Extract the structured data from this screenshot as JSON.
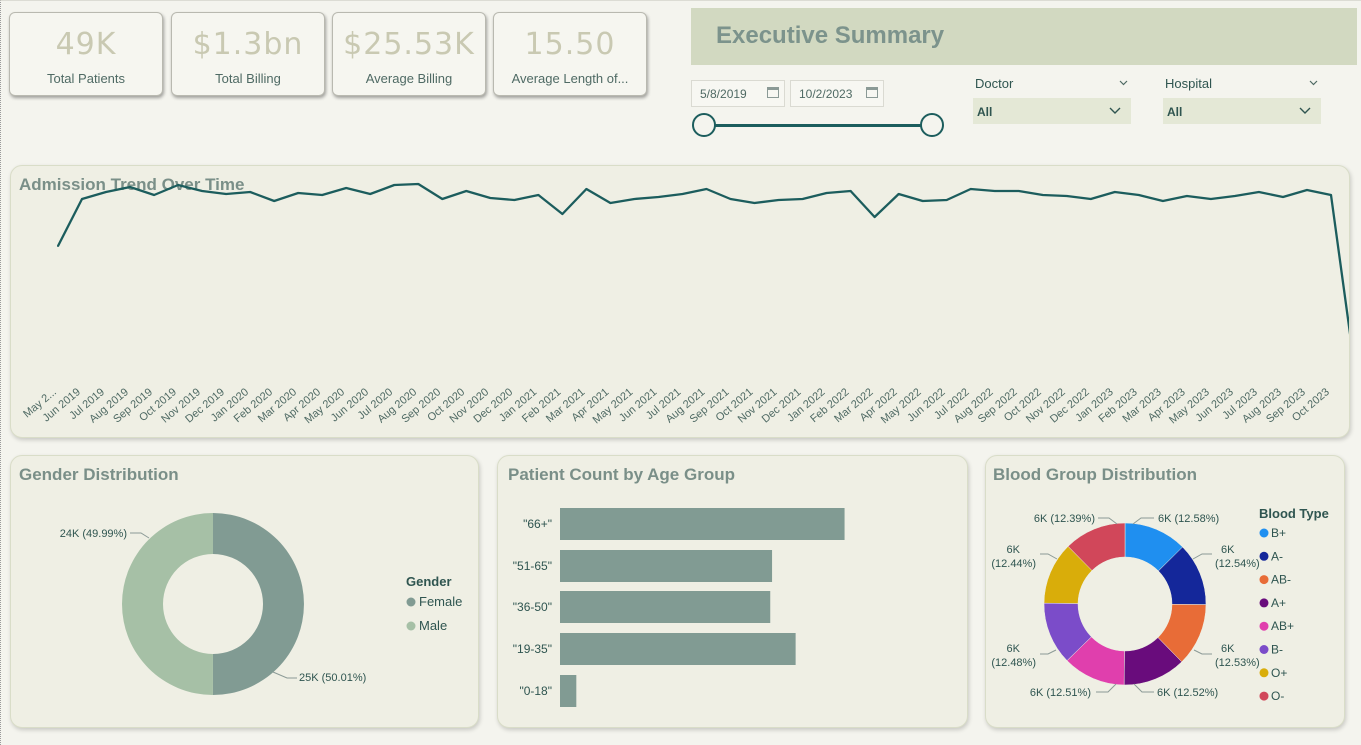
{
  "kpis": [
    {
      "value": "49K",
      "label": "Total Patients"
    },
    {
      "value": "$1.3bn",
      "label": "Total Billing"
    },
    {
      "value": "$25.53K",
      "label": "Average Billing"
    },
    {
      "value": "15.50",
      "label": "Average Length of..."
    }
  ],
  "header": {
    "title": "Executive Summary"
  },
  "date_range": {
    "start": "5/8/2019",
    "end": "10/2/2023"
  },
  "filters": {
    "doctor": {
      "label": "Doctor",
      "value": "All"
    },
    "hospital": {
      "label": "Hospital",
      "value": "All"
    }
  },
  "panels": {
    "trend": {
      "title": "Admission Trend Over Time"
    },
    "gender": {
      "title": "Gender Distribution"
    },
    "age": {
      "title": "Patient Count by Age Group"
    },
    "blood": {
      "title": "Blood Group Distribution"
    }
  },
  "colors": {
    "teal": "#1c5d5d",
    "gender_female": "#819b93",
    "gender_male": "#a6c0a6",
    "bar": "#819b93"
  },
  "chart_data": [
    {
      "type": "line",
      "title": "Admission Trend Over Time",
      "x": [
        "May 2...",
        "Jun 2019",
        "Jul 2019",
        "Aug 2019",
        "Sep 2019",
        "Oct 2019",
        "Nov 2019",
        "Dec 2019",
        "Jan 2020",
        "Feb 2020",
        "Mar 2020",
        "Apr 2020",
        "May 2020",
        "Jun 2020",
        "Jul 2020",
        "Aug 2020",
        "Sep 2020",
        "Oct 2020",
        "Nov 2020",
        "Dec 2020",
        "Jan 2021",
        "Feb 2021",
        "Mar 2021",
        "Apr 2021",
        "May 2021",
        "Jun 2021",
        "Jul 2021",
        "Aug 2021",
        "Sep 2021",
        "Oct 2021",
        "Nov 2021",
        "Dec 2021",
        "Jan 2022",
        "Feb 2022",
        "Mar 2022",
        "Apr 2022",
        "May 2022",
        "Jun 2022",
        "Jul 2022",
        "Aug 2022",
        "Sep 2022",
        "Oct 2022",
        "Nov 2022",
        "Dec 2022",
        "Jan 2023",
        "Feb 2023",
        "Mar 2023",
        "Apr 2023",
        "May 2023",
        "Jun 2023",
        "Jul 2023",
        "Aug 2023",
        "Sep 2023",
        "Oct 2023"
      ],
      "series": [
        {
          "values": [
            700,
            935,
            970,
            995,
            955,
            1005,
            975,
            960,
            970,
            925,
            965,
            955,
            990,
            960,
            1005,
            1010,
            935,
            975,
            940,
            930,
            955,
            860,
            985,
            915,
            935,
            945,
            960,
            985,
            935,
            915,
            930,
            935,
            965,
            975,
            845,
            960,
            925,
            930,
            985,
            975,
            975,
            955,
            950,
            935,
            970,
            955,
            925,
            950,
            935,
            950,
            970,
            945,
            980,
            955,
            80
          ]
        }
      ],
      "ylim": [
        0,
        1100
      ],
      "grid": false
    },
    {
      "type": "pie",
      "title": "Gender Distribution",
      "legend_title": "Gender",
      "legend_position": "right",
      "slices": [
        {
          "name": "Female",
          "value": 50.01,
          "label": "25K (50.01%)",
          "color": "#819b93"
        },
        {
          "name": "Male",
          "value": 49.99,
          "label": "24K (49.99%)",
          "color": "#a6c0a6"
        }
      ]
    },
    {
      "type": "bar",
      "orientation": "horizontal",
      "title": "Patient Count by Age Group",
      "categories": [
        "\"66+\"",
        "\"51-65\"",
        "\"36-50\"",
        "\"19-35\"",
        "\"0-18\""
      ],
      "values": [
        15700,
        11700,
        11600,
        13000,
        900
      ],
      "xlim": [
        0,
        20000
      ]
    },
    {
      "type": "pie",
      "title": "Blood Group Distribution",
      "legend_title": "Blood Type",
      "legend_position": "right",
      "slices": [
        {
          "name": "B+",
          "value": 12.58,
          "label": "6K (12.58%)",
          "color": "#1f8ff0"
        },
        {
          "name": "A-",
          "value": 12.54,
          "label": "6K (12.54%)",
          "color": "#14279a"
        },
        {
          "name": "AB-",
          "value": 12.53,
          "label": "6K (12.53%)",
          "color": "#e86c37"
        },
        {
          "name": "A+",
          "value": 12.52,
          "label": "6K (12.52%)",
          "color": "#690c7c"
        },
        {
          "name": "AB+",
          "value": 12.51,
          "label": "6K (12.51%)",
          "color": "#e03fad"
        },
        {
          "name": "B-",
          "value": 12.48,
          "label": "6K (12.48%)",
          "color": "#7b4cc9"
        },
        {
          "name": "O+",
          "value": 12.44,
          "label": "6K (12.44%)",
          "color": "#d9ad0a"
        },
        {
          "name": "O-",
          "value": 12.39,
          "label": "6K (12.39%)",
          "color": "#d1475a"
        }
      ]
    }
  ]
}
